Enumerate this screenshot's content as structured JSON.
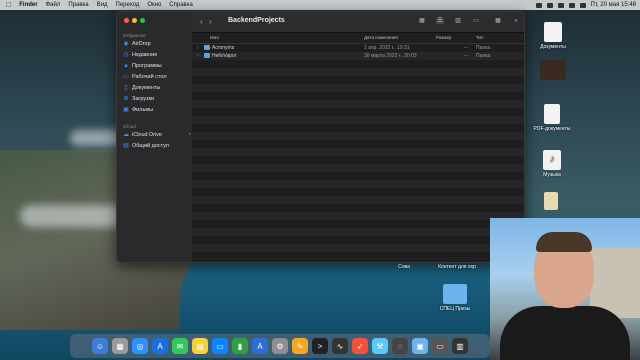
{
  "menubar": {
    "items": [
      "Finder",
      "Файл",
      "Правка",
      "Вид",
      "Переход",
      "Окно",
      "Справка"
    ],
    "clock": "Пт, 20 мая 15:48"
  },
  "finder": {
    "title": "BackendProjects",
    "sidebar": {
      "favorites_header": "Избранное",
      "favorites": [
        {
          "label": "AirDrop",
          "icon": "airdrop-icon"
        },
        {
          "label": "Недавние",
          "icon": "clock-icon"
        },
        {
          "label": "Программы",
          "icon": "apps-icon"
        },
        {
          "label": "Рабочий стол",
          "icon": "desktop-icon"
        },
        {
          "label": "Документы",
          "icon": "document-icon"
        },
        {
          "label": "Загрузки",
          "icon": "download-icon"
        },
        {
          "label": "Фильмы",
          "icon": "film-icon"
        }
      ],
      "icloud_header": "iCloud",
      "icloud": [
        {
          "label": "iCloud Drive",
          "icon": "cloud-icon"
        },
        {
          "label": "Общий доступ",
          "icon": "shared-folder-icon"
        }
      ]
    },
    "columns": {
      "name": "Имя",
      "date": "Дата изменения",
      "size": "Размер",
      "kind": "Тип"
    },
    "rows": [
      {
        "name": "Acronyms",
        "date": "1 апр. 2022 г., 19:31",
        "size": "--",
        "kind": "Папка"
      },
      {
        "name": "HelloVapor",
        "date": "30 марта 2022 г., 20:03",
        "size": "--",
        "kind": "Папка"
      }
    ]
  },
  "desktop": {
    "icons": [
      {
        "label": "Документы"
      },
      {
        "label": "PDF-документы"
      },
      {
        "label": "Музыка"
      },
      {
        "label": "Сова"
      },
      {
        "label": "Контент для охр"
      },
      {
        "label": "СПЕЦ Презы"
      }
    ]
  },
  "colors": {
    "accent": "#3d8cff",
    "folder": "#58a6e8"
  }
}
